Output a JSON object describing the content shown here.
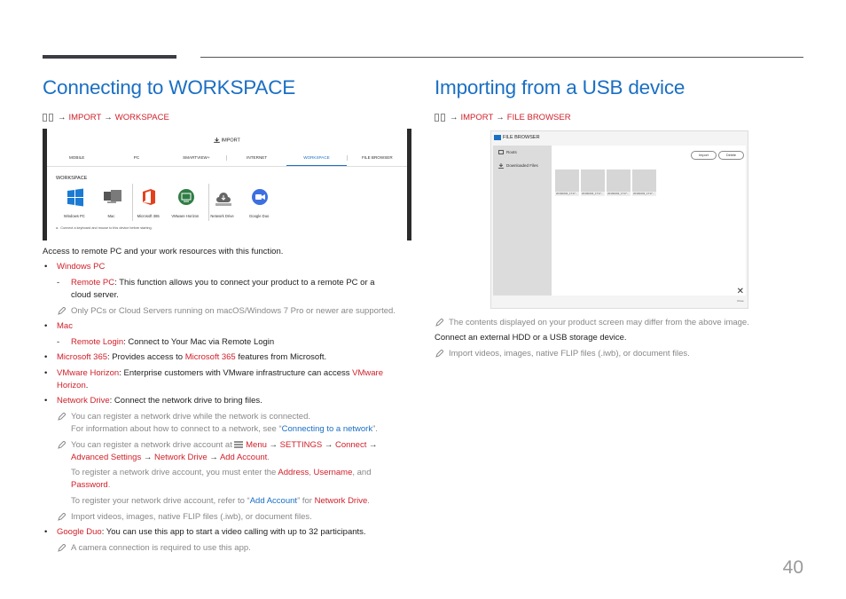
{
  "left": {
    "title": "Connecting to WORKSPACE",
    "crumb": {
      "import": "IMPORT",
      "target": "WORKSPACE"
    },
    "screenshot": {
      "header": "IMPORT",
      "tabs": [
        "MOBILE",
        "PC",
        "SMARTVIEW+",
        "INTERNET",
        "WORKSPACE",
        "FILE BROWSER"
      ],
      "active_tab": "WORKSPACE",
      "section_title": "WORKSPACE",
      "apps": [
        "Windows PC",
        "Mac",
        "Microsoft 365",
        "VMware Horizon",
        "Network Drive",
        "Google Duo"
      ],
      "note": "Connect a keyboard and mouse to this device before starting."
    },
    "intro": "Access to remote PC and your work resources with this function.",
    "windows_pc": "Windows PC",
    "remote_pc_term": "Remote PC",
    "remote_pc_line1": ": This function allows you to connect your product to a remote PC or a",
    "remote_pc_line2": "cloud server.",
    "memo_win": "Only PCs or Cloud Servers running on macOS/Windows 7 Pro or newer are supported.",
    "mac": "Mac",
    "remote_login_term": "Remote Login",
    "remote_login_text": ": Connect to Your Mac via Remote Login",
    "ms365_term": "Microsoft 365",
    "ms365_text1": ": Provides access to ",
    "ms365_term2": "Microsoft 365",
    "ms365_text2": " features from Microsoft.",
    "vmware_term": "VMware Horizon",
    "vmware_text": ": Enterprise customers with VMware infrastructure can access ",
    "vmware_term2a": "VMware",
    "vmware_term2b": "Horizon",
    "vmware_dot": ".",
    "nd_term": "Network Drive",
    "nd_text": ": Connect the network drive to bring files.",
    "memo_nd1": "You can register a network drive while the network is connected.",
    "memo_nd2a": "For information about how to connect to a network, see “",
    "memo_nd2_link": "Connecting to a network",
    "memo_nd2b": "”.",
    "memo_nd3a": "You can register a network drive account at ",
    "menu": "Menu",
    "settings": "SETTINGS",
    "connect": "Connect",
    "advanced": "Advanced Settings",
    "network_drive": "Network Drive",
    "add_account": "Add Account",
    "arrow": "→",
    "memo_nd4a": "To register a network drive account, you must enter the ",
    "address": "Address",
    "comma": ", ",
    "username": "Username",
    "and": ", and",
    "password": "Password",
    "dot": ".",
    "memo_nd5a": "To register your network drive account, refer to “",
    "memo_nd5_link": "Add Account",
    "memo_nd5b": "” for ",
    "memo_nd5_term": "Network Drive",
    "memo_import": "Import videos, images, native FLIP files (.iwb), or document files.",
    "duo_term": "Google Duo",
    "duo_text": ": You can use this app to start a video calling with up to 32 participants.",
    "memo_duo": "A camera connection is required to use this app."
  },
  "right": {
    "title": "Importing from a USB device",
    "crumb": {
      "import": "IMPORT",
      "target": "FILE BROWSER"
    },
    "screenshot": {
      "header": "FILE BROWSER",
      "side_items": [
        "Roots",
        "Downloaded Files"
      ],
      "buttons": [
        "Import",
        "Delete"
      ],
      "thumb_captions": [
        "20190204_1717...",
        "20190204_1717...",
        "20190204_1717...",
        "20190204_1717..."
      ],
      "close_label": "Close"
    },
    "memo1": "The contents displayed on your product screen may differ from the above image.",
    "text1": "Connect an external HDD or a USB storage device.",
    "memo2": "Import videos, images, native FLIP files (.iwb), or document files."
  },
  "page_number": "40",
  "colors": {
    "accent_blue": "#1a6fc4",
    "accent_red": "#d0202a"
  }
}
